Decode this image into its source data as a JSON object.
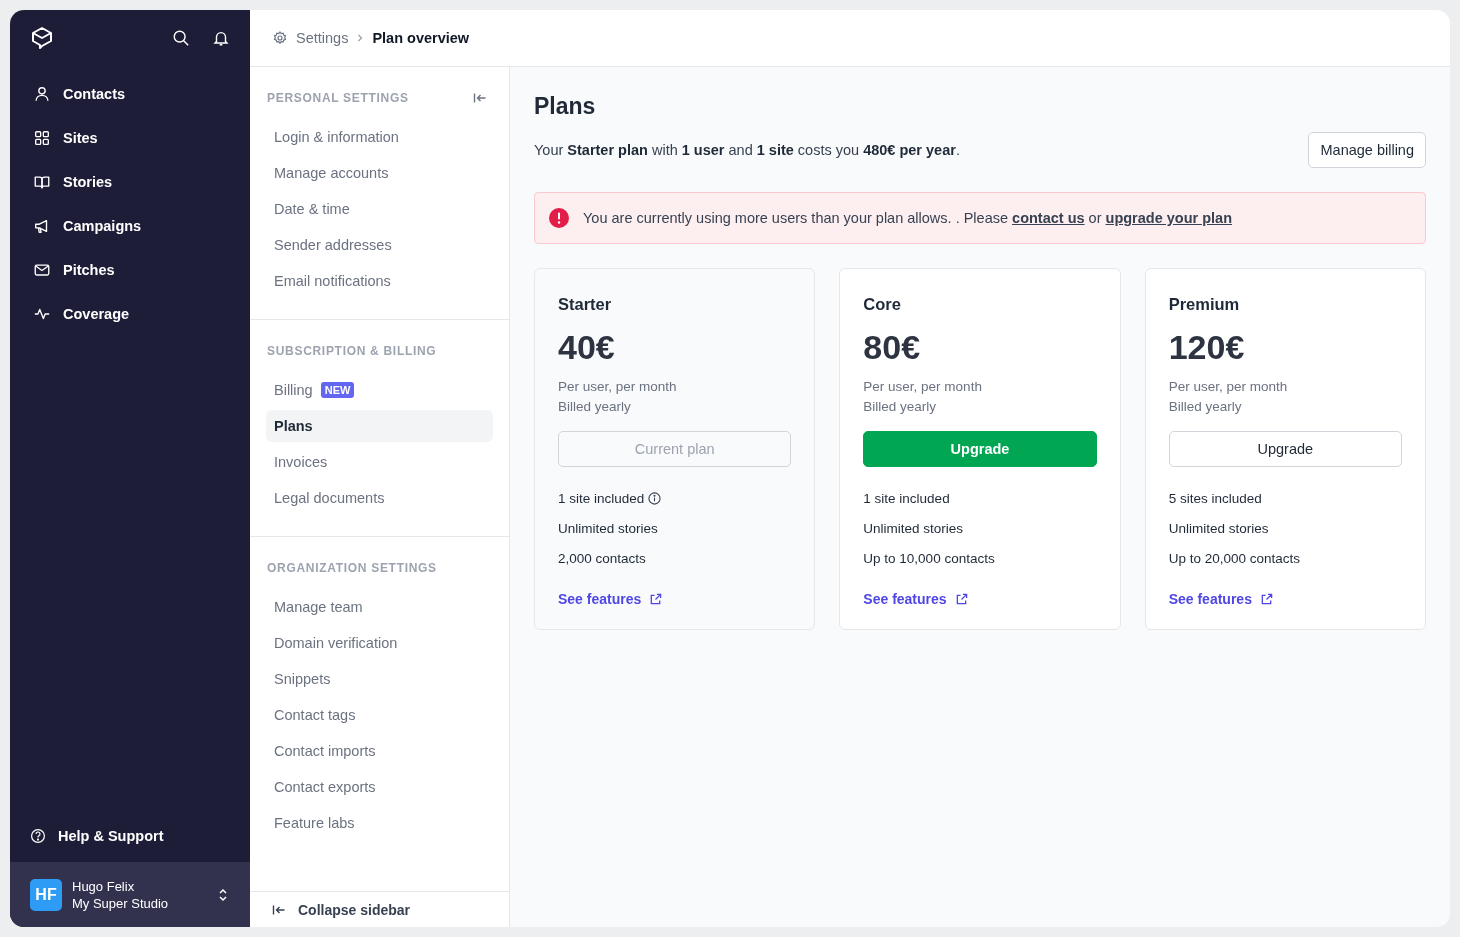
{
  "nav": {
    "items": [
      {
        "label": "Contacts"
      },
      {
        "label": "Sites"
      },
      {
        "label": "Stories"
      },
      {
        "label": "Campaigns"
      },
      {
        "label": "Pitches"
      },
      {
        "label": "Coverage"
      }
    ],
    "help": "Help & Support",
    "user": {
      "initials": "HF",
      "name": "Hugo Felix",
      "org": "My Super Studio"
    }
  },
  "breadcrumb": [
    "Settings",
    "Plan overview"
  ],
  "settings": {
    "sections": [
      {
        "title": "PERSONAL SETTINGS",
        "items": [
          {
            "label": "Login & information",
            "selected": false
          },
          {
            "label": "Manage accounts",
            "selected": false
          },
          {
            "label": "Date & time",
            "selected": false
          },
          {
            "label": "Sender addresses",
            "selected": false
          },
          {
            "label": "Email notifications",
            "selected": false
          }
        ]
      },
      {
        "title": "SUBSCRIPTION & BILLING",
        "items": [
          {
            "label": "Billing",
            "badge": "NEW",
            "selected": false
          },
          {
            "label": "Plans",
            "selected": true
          },
          {
            "label": "Invoices",
            "selected": false
          },
          {
            "label": "Legal documents",
            "selected": false
          }
        ]
      },
      {
        "title": "ORGANIZATION SETTINGS",
        "items": [
          {
            "label": "Manage team",
            "selected": false
          },
          {
            "label": "Domain verification",
            "selected": false
          },
          {
            "label": "Snippets",
            "selected": false
          },
          {
            "label": "Contact tags",
            "selected": false
          },
          {
            "label": "Contact imports",
            "selected": false
          },
          {
            "label": "Contact exports",
            "selected": false
          },
          {
            "label": "Feature labs",
            "selected": false
          }
        ]
      }
    ],
    "collapse": "Collapse sidebar"
  },
  "page": {
    "title": "Plans",
    "summary": "Your **Starter plan** with **1 user** and **1 site** costs you **480€ per year**.",
    "manage_button": "Manage billing",
    "alert": {
      "text": "You are currently using more users than your plan allows. . Please",
      "link1": "contact us",
      "joiner": "or",
      "link2": "upgrade your plan"
    }
  },
  "plans": [
    {
      "name": "Starter",
      "price": "40€",
      "per": "Per user, per month",
      "billing": "Billed yearly",
      "button": "Current plan",
      "kind": "current",
      "features": [
        {
          "text": "1 site included",
          "info": true
        },
        {
          "text": "Unlimited stories",
          "info": false
        },
        {
          "text": "2,000 contacts",
          "info": false
        }
      ],
      "link": "See features"
    },
    {
      "name": "Core",
      "price": "80€",
      "per": "Per user, per month",
      "billing": "Billed yearly",
      "button": "Upgrade",
      "kind": "primary",
      "features": [
        {
          "text": "1 site included",
          "info": false
        },
        {
          "text": "Unlimited stories",
          "info": false
        },
        {
          "text": "Up to 10,000 contacts",
          "info": false
        }
      ],
      "link": "See features"
    },
    {
      "name": "Premium",
      "price": "120€",
      "per": "Per user, per month",
      "billing": "Billed yearly",
      "button": "Upgrade",
      "kind": "secondary",
      "features": [
        {
          "text": "5 sites included",
          "info": false
        },
        {
          "text": "Unlimited stories",
          "info": false
        },
        {
          "text": "Up to 20,000 contacts",
          "info": false
        }
      ],
      "link": "See features"
    }
  ]
}
